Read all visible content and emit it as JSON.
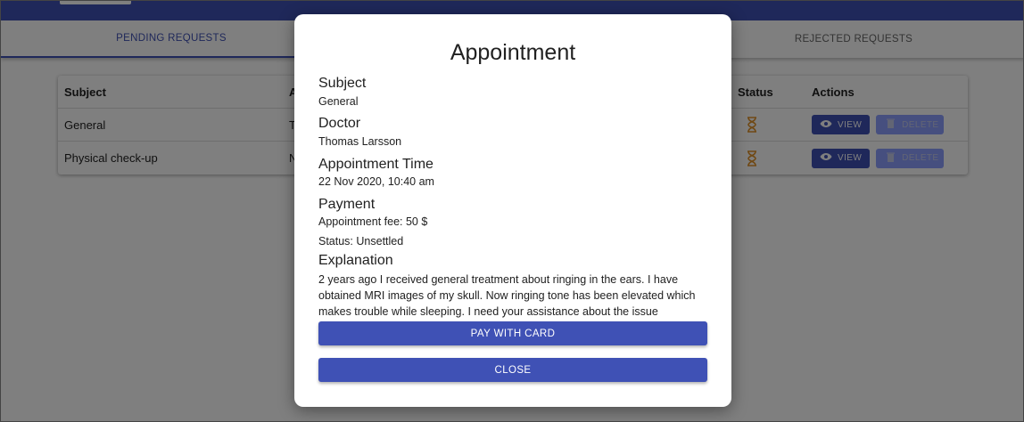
{
  "tabs": [
    {
      "label": "PENDING REQUESTS"
    },
    {
      "label": "REJECTED REQUESTS"
    }
  ],
  "table": {
    "headers": {
      "subject": "Subject",
      "a": "A",
      "status": "Status",
      "actions": "Actions"
    },
    "rows": [
      {
        "subject": "General",
        "a": "T",
        "status_icon": "hourglass-icon"
      },
      {
        "subject": "Physical check-up",
        "a": "N",
        "status_icon": "hourglass-icon"
      }
    ],
    "view_label": "VIEW",
    "delete_label": "DELETE"
  },
  "modal": {
    "title": "Appointment",
    "subject_heading": "Subject",
    "subject_value": "General",
    "doctor_heading": "Doctor",
    "doctor_value": "Thomas Larsson",
    "time_heading": "Appointment Time",
    "time_value": "22 Nov 2020, 10:40 am",
    "payment_heading": "Payment",
    "fee_text": "Appointment fee: 50 $",
    "status_text": "Status: Unsettled",
    "explanation_heading": "Explanation",
    "explanation_text": "2 years ago I received general treatment about ringing in the ears. I have obtained MRI images of my skull. Now ringing tone has been elevated which makes trouble while sleeping. I need your assistance about the issue",
    "pay_button": "PAY WITH CARD",
    "close_button": "CLOSE"
  },
  "colors": {
    "primary": "#3f51b5",
    "pending": "#e0922a",
    "delete_disabled": "#8c9eff"
  }
}
